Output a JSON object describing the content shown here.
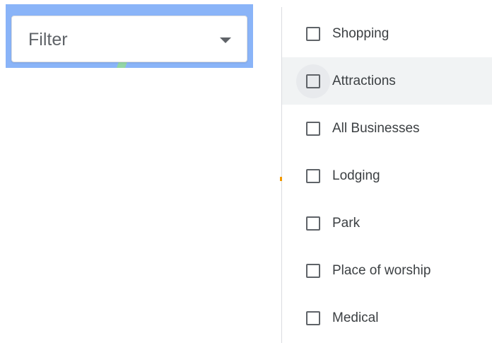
{
  "filter": {
    "label": "Filter",
    "icon": "chevron-down-icon"
  },
  "menu": {
    "hovered_index": 1,
    "items": [
      {
        "label": "Shopping",
        "checked": false
      },
      {
        "label": "Attractions",
        "checked": false
      },
      {
        "label": "All Businesses",
        "checked": false
      },
      {
        "label": "Lodging",
        "checked": false
      },
      {
        "label": "Park",
        "checked": false
      },
      {
        "label": "Place of worship",
        "checked": false
      },
      {
        "label": "Medical",
        "checked": false
      }
    ]
  },
  "colors": {
    "map_water": "#8ab4f8",
    "text": "#3c4043",
    "hover_bg": "#f1f3f4",
    "checkbox_border": "#5f6368"
  }
}
